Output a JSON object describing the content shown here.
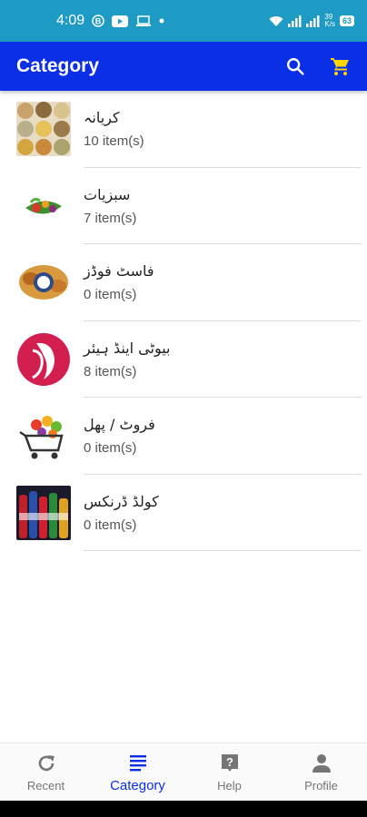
{
  "status_bar": {
    "time": "4:09",
    "net_speed_top": "39",
    "net_speed_bottom": "K/s",
    "battery": "63"
  },
  "app_bar": {
    "title": "Category"
  },
  "categories": [
    {
      "name": "کریانہ",
      "count": "10 item(s)"
    },
    {
      "name": "سبزیات",
      "count": "7 item(s)"
    },
    {
      "name": "فاسٹ فوڈز",
      "count": "0 item(s)"
    },
    {
      "name": "بیوٹی اینڈ ہیئر",
      "count": "8 item(s)"
    },
    {
      "name": "فروٹ / پھل",
      "count": "0 item(s)"
    },
    {
      "name": "کولڈ ڈرنکس",
      "count": "0 item(s)"
    }
  ],
  "bottom_nav": [
    {
      "label": "Recent",
      "icon": "refresh-icon"
    },
    {
      "label": "Category",
      "icon": "list-icon"
    },
    {
      "label": "Help",
      "icon": "help-icon"
    },
    {
      "label": "Profile",
      "icon": "person-icon"
    }
  ],
  "colors": {
    "status_bar": "#1e9bc4",
    "app_bar": "#0a2fe6",
    "cart_icon": "#ffd600",
    "active_nav": "#0a2fe6",
    "inactive_nav": "#757575"
  }
}
